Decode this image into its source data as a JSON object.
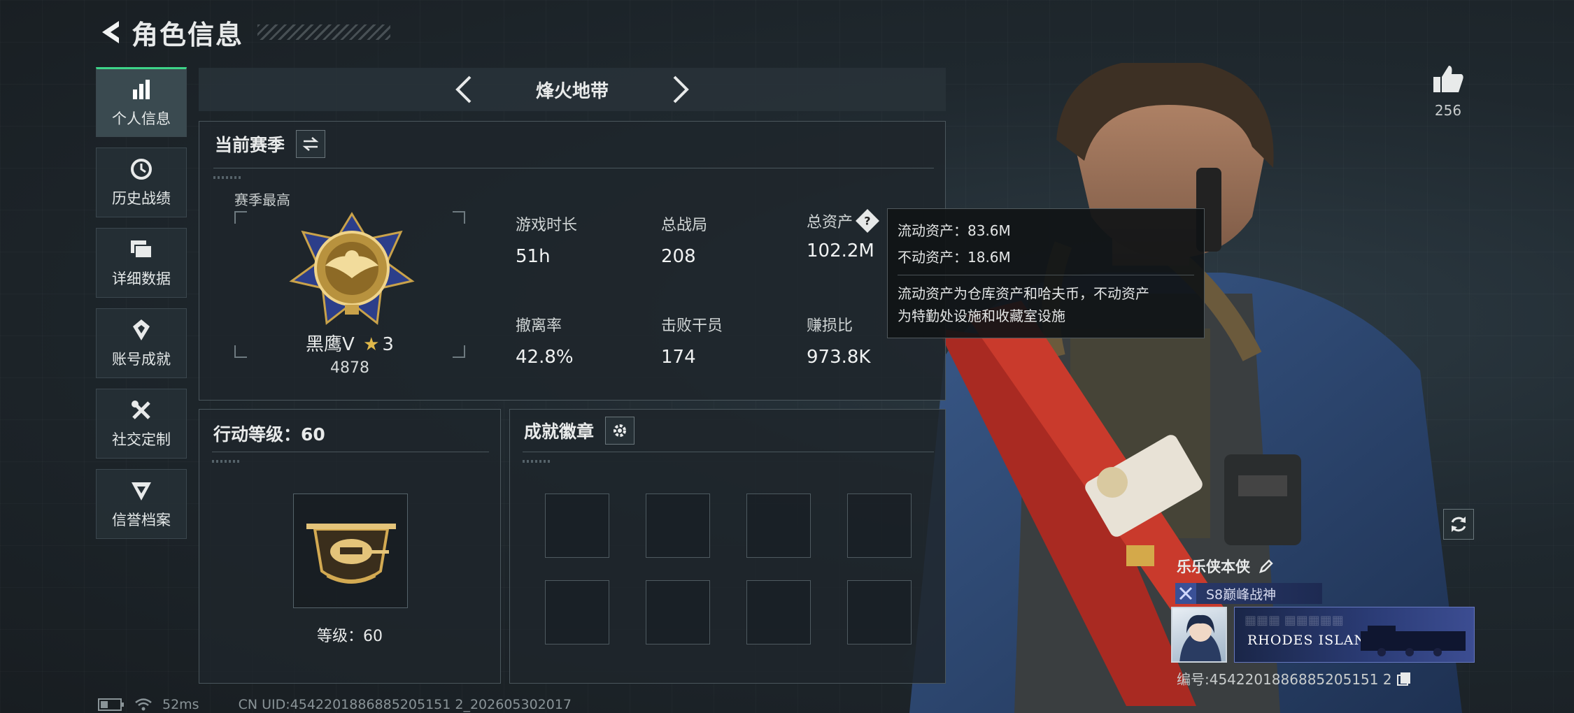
{
  "header": {
    "title": "角色信息"
  },
  "nav": {
    "items": [
      {
        "label": "个人信息",
        "icon": "bar-chart-icon",
        "active": true
      },
      {
        "label": "历史战绩",
        "icon": "history-clock-icon"
      },
      {
        "label": "详细数据",
        "icon": "folder-icon"
      },
      {
        "label": "账号成就",
        "icon": "achievement-icon"
      },
      {
        "label": "社交定制",
        "icon": "tools-icon"
      },
      {
        "label": "信誉档案",
        "icon": "shield-chevron-icon"
      }
    ]
  },
  "mode": {
    "title": "烽火地带"
  },
  "season": {
    "title": "当前赛季",
    "best_label": "赛季最高",
    "rank_name": "黑鹰V",
    "rank_stars": "3",
    "rank_score": "4878",
    "stats": [
      {
        "key": "游戏时长",
        "value": "51h"
      },
      {
        "key": "总战局",
        "value": "208"
      },
      {
        "key": "总资产",
        "value": "102.2M"
      },
      {
        "key": "撤离率",
        "value": "42.8%"
      },
      {
        "key": "击败干员",
        "value": "174"
      },
      {
        "key": "赚损比",
        "value": "973.8K"
      }
    ]
  },
  "tooltip": {
    "liquid": "流动资产：83.6M",
    "fixed": "不动资产：18.6M",
    "desc_line1": "流动资产为仓库资产和哈夫币，不动资产",
    "desc_line2": "为特勤处设施和收藏室设施"
  },
  "level": {
    "title": "行动等级：60",
    "label": "等级：60"
  },
  "achievements": {
    "title": "成就徽章"
  },
  "likes": {
    "count": "256"
  },
  "player": {
    "name": "乐乐侠本侠",
    "title_badge": "S8巅峰战神",
    "nameplate_text": "RHODES ISLAND",
    "uid_line": "编号:4542201886885205151 2"
  },
  "statusbar": {
    "ping": "52ms",
    "uid": "CN UID:4542201886885205151 2_202605302017"
  },
  "colors": {
    "accent_green": "#3dd488",
    "gold": "#c9a24a"
  }
}
